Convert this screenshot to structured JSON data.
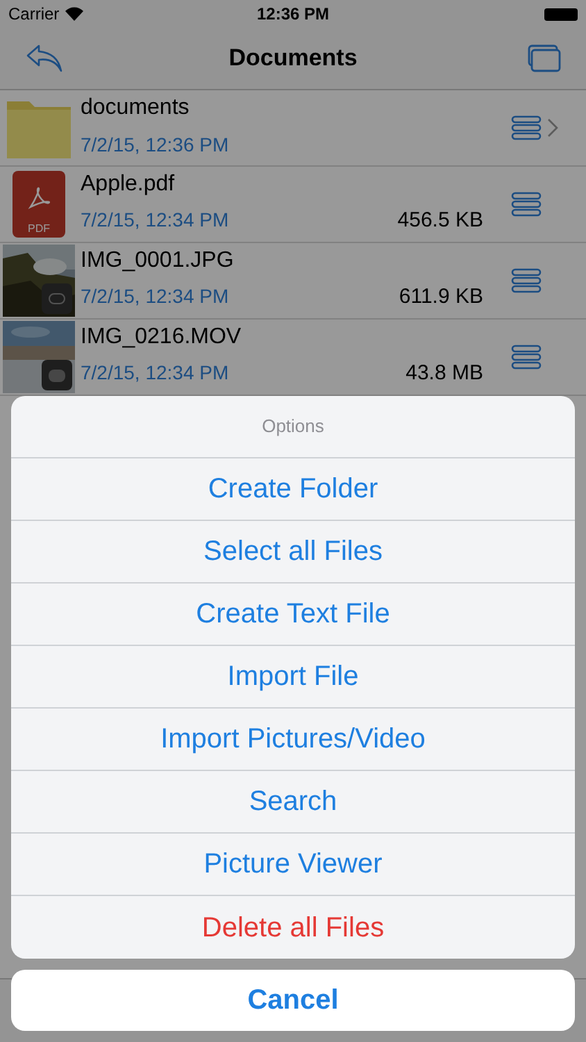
{
  "status_bar": {
    "carrier": "Carrier",
    "time": "12:36 PM"
  },
  "nav_bar": {
    "title": "Documents"
  },
  "files": [
    {
      "kind": "folder",
      "name": "documents",
      "date": "7/2/15, 12:36 PM"
    },
    {
      "kind": "pdf",
      "name": "Apple.pdf",
      "date": "7/2/15, 12:34 PM",
      "size": "456.5 KB",
      "badge": "PDF"
    },
    {
      "name": "IMG_0001.JPG",
      "date": "7/2/15, 12:34 PM",
      "size": "611.9 KB"
    },
    {
      "kind": "video",
      "name": "IMG_0216.MOV",
      "date": "7/2/15, 12:34 PM",
      "size": "43.8 MB"
    }
  ],
  "action_sheet": {
    "title": "Options",
    "actions": [
      {
        "label": "Create Folder",
        "kind": "default"
      },
      {
        "label": "Select all Files",
        "kind": "default"
      },
      {
        "label": "Create Text File",
        "kind": "default"
      },
      {
        "label": "Import File",
        "kind": "default"
      },
      {
        "label": "Import Pictures/Video",
        "kind": "default"
      },
      {
        "label": "Search",
        "kind": "default"
      },
      {
        "label": "Picture Viewer",
        "kind": "default"
      },
      {
        "label": "Delete all Files",
        "kind": "destructive"
      }
    ],
    "cancel": "Cancel"
  }
}
